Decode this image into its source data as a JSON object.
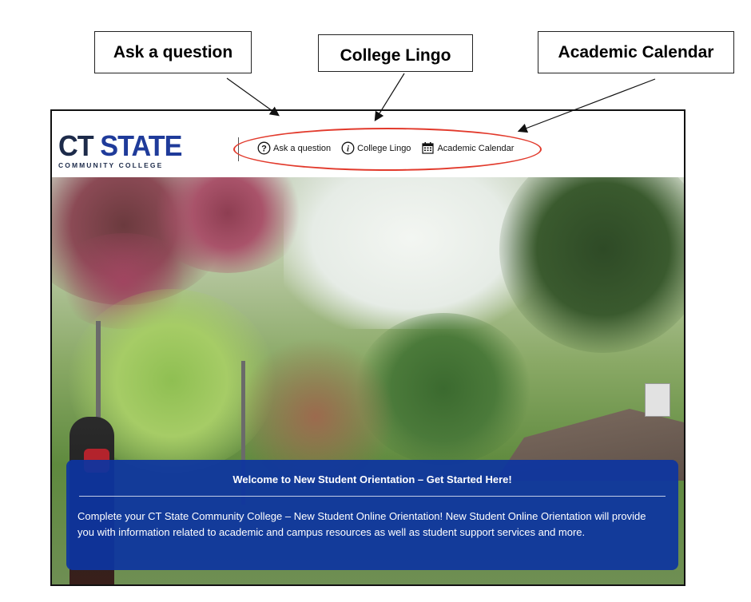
{
  "callouts": {
    "ask": "Ask a question",
    "lingo": "College Lingo",
    "calendar": "Academic Calendar"
  },
  "header": {
    "logo": {
      "line1_a": "CT",
      "line1_b": "STATE",
      "line2": "COMMUNITY COLLEGE"
    },
    "nav": [
      {
        "label": "Ask a question",
        "icon": "question-circle-icon"
      },
      {
        "label": "College Lingo",
        "icon": "info-circle-icon"
      },
      {
        "label": "Academic Calendar",
        "icon": "calendar-icon"
      }
    ]
  },
  "welcome": {
    "title": "Welcome to New Student Orientation – Get Started Here!",
    "body": "Complete your CT State Community College – New Student Online Orientation! New Student Online Orientation will provide you with information related to academic and campus resources as well as student support services and more."
  },
  "colors": {
    "annotation": "#e23a2c",
    "brand_navy": "#1d2b4a",
    "brand_blue": "#1f3b9a",
    "panel_blue": "#0d35a0"
  }
}
